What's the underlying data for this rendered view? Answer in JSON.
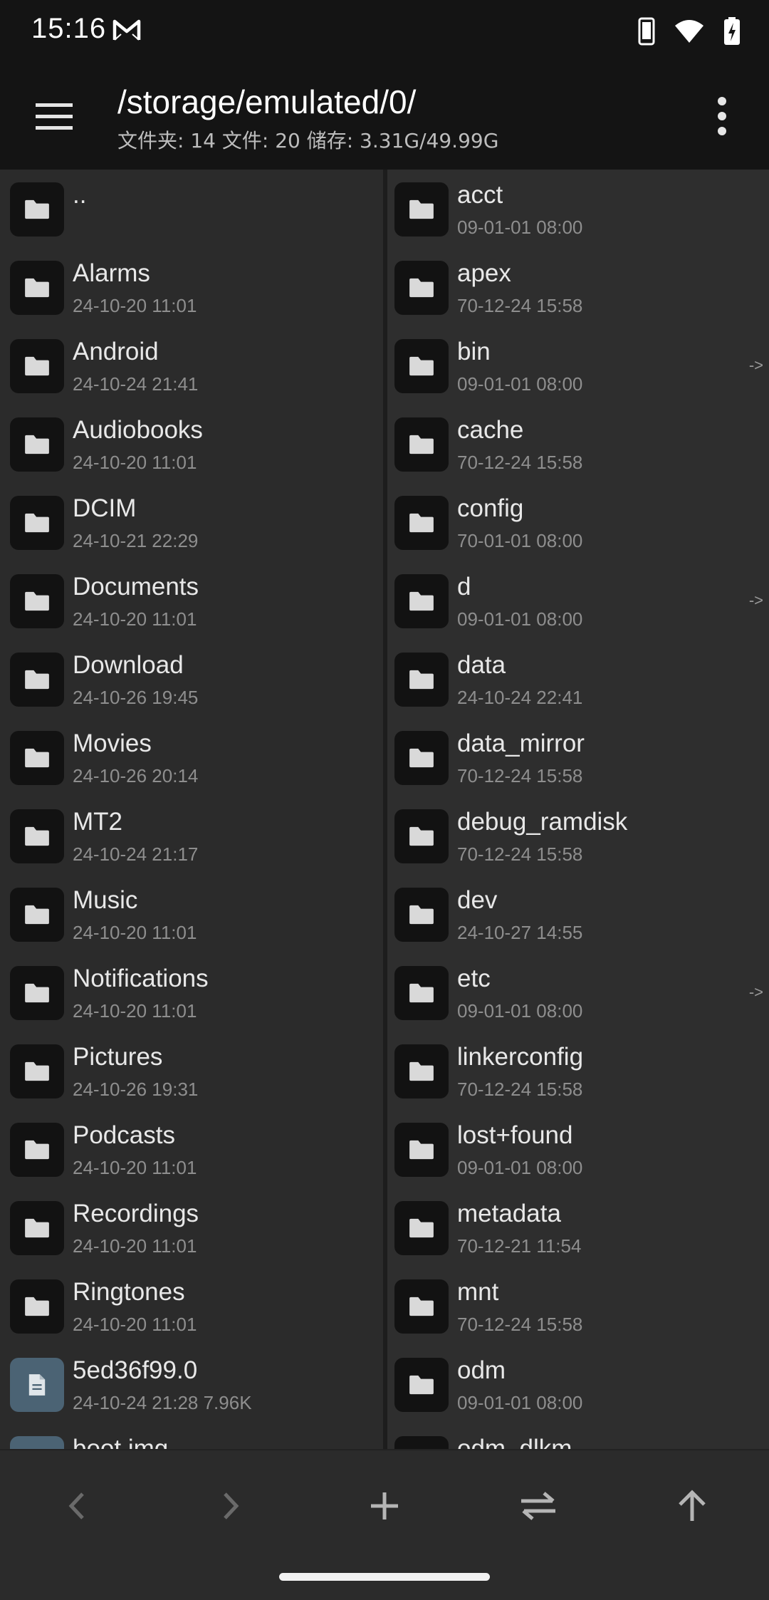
{
  "status_bar": {
    "time": "15:16"
  },
  "toolbar": {
    "path": "/storage/emulated/0/",
    "info": "文件夹: 14  文件: 20  储存: 3.31G/49.99G"
  },
  "left_pane": {
    "items": [
      {
        "name": "..",
        "date": "",
        "type": "folder"
      },
      {
        "name": "Alarms",
        "date": "24-10-20 11:01",
        "type": "folder"
      },
      {
        "name": "Android",
        "date": "24-10-24 21:41",
        "type": "folder"
      },
      {
        "name": "Audiobooks",
        "date": "24-10-20 11:01",
        "type": "folder"
      },
      {
        "name": "DCIM",
        "date": "24-10-21 22:29",
        "type": "folder"
      },
      {
        "name": "Documents",
        "date": "24-10-20 11:01",
        "type": "folder"
      },
      {
        "name": "Download",
        "date": "24-10-26 19:45",
        "type": "folder"
      },
      {
        "name": "Movies",
        "date": "24-10-26 20:14",
        "type": "folder"
      },
      {
        "name": "MT2",
        "date": "24-10-24 21:17",
        "type": "folder"
      },
      {
        "name": "Music",
        "date": "24-10-20 11:01",
        "type": "folder"
      },
      {
        "name": "Notifications",
        "date": "24-10-20 11:01",
        "type": "folder"
      },
      {
        "name": "Pictures",
        "date": "24-10-26 19:31",
        "type": "folder"
      },
      {
        "name": "Podcasts",
        "date": "24-10-20 11:01",
        "type": "folder"
      },
      {
        "name": "Recordings",
        "date": "24-10-20 11:01",
        "type": "folder"
      },
      {
        "name": "Ringtones",
        "date": "24-10-20 11:01",
        "type": "folder"
      },
      {
        "name": "5ed36f99.0",
        "date": "24-10-24 21:28  7.96K",
        "type": "file"
      },
      {
        "name": "boot.img",
        "date": "",
        "type": "file"
      }
    ]
  },
  "right_pane": {
    "items": [
      {
        "name": "acct",
        "date": "09-01-01 08:00",
        "link": ""
      },
      {
        "name": "apex",
        "date": "70-12-24 15:58",
        "link": ""
      },
      {
        "name": "bin",
        "date": "09-01-01 08:00",
        "link": "->"
      },
      {
        "name": "cache",
        "date": "70-12-24 15:58",
        "link": ""
      },
      {
        "name": "config",
        "date": "70-01-01 08:00",
        "link": ""
      },
      {
        "name": "d",
        "date": "09-01-01 08:00",
        "link": "->"
      },
      {
        "name": "data",
        "date": "24-10-24 22:41",
        "link": ""
      },
      {
        "name": "data_mirror",
        "date": "70-12-24 15:58",
        "link": ""
      },
      {
        "name": "debug_ramdisk",
        "date": "70-12-24 15:58",
        "link": ""
      },
      {
        "name": "dev",
        "date": "24-10-27 14:55",
        "link": ""
      },
      {
        "name": "etc",
        "date": "09-01-01 08:00",
        "link": "->"
      },
      {
        "name": "linkerconfig",
        "date": "70-12-24 15:58",
        "link": ""
      },
      {
        "name": "lost+found",
        "date": "09-01-01 08:00",
        "link": ""
      },
      {
        "name": "metadata",
        "date": "70-12-21 11:54",
        "link": ""
      },
      {
        "name": "mnt",
        "date": "70-12-24 15:58",
        "link": ""
      },
      {
        "name": "odm",
        "date": "09-01-01 08:00",
        "link": ""
      },
      {
        "name": "odm_dlkm",
        "date": "",
        "link": ""
      }
    ]
  },
  "bottom_bar": {
    "buttons": [
      {
        "icon": "chevron-left-icon"
      },
      {
        "icon": "chevron-right-icon"
      },
      {
        "icon": "plus-icon"
      },
      {
        "icon": "swap-icon"
      },
      {
        "icon": "arrow-up-icon"
      }
    ]
  },
  "colors": {
    "background": "#2d2d2d",
    "toolbar": "#141414",
    "folder_icon_bg": "#121212",
    "file_icon_bg": "#4b6374"
  }
}
